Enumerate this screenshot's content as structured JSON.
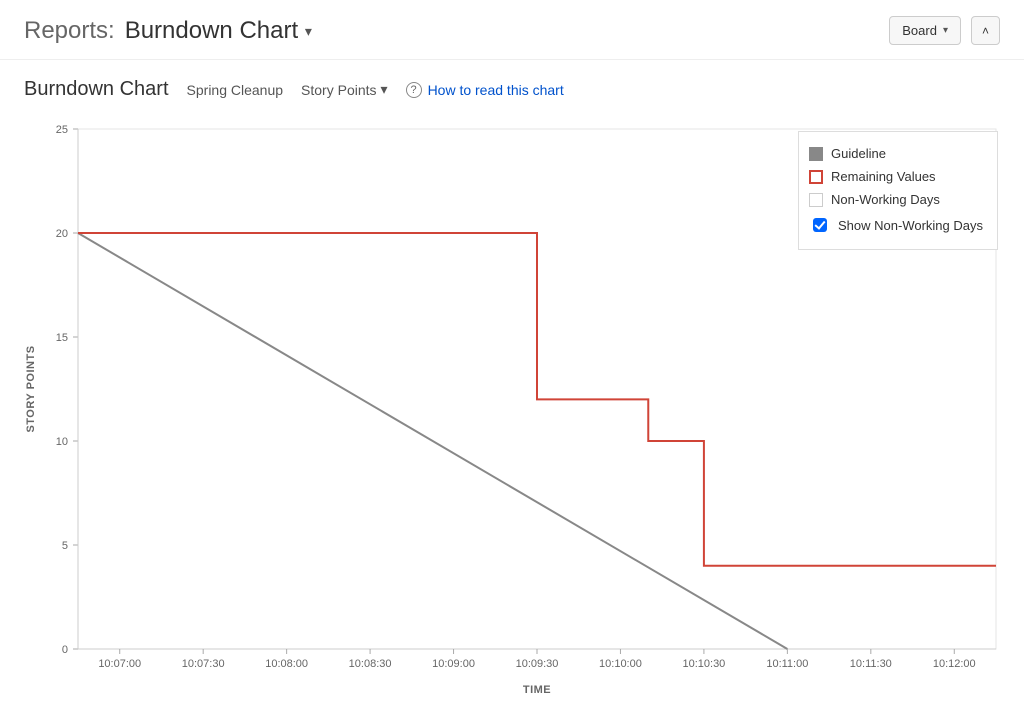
{
  "header": {
    "breadcrumb_label": "Reports:",
    "report_title": "Burndown Chart",
    "board_button": "Board",
    "collapse_icon_title": "Collapse"
  },
  "subheader": {
    "title": "Burndown Chart",
    "sprint_name": "Spring Cleanup",
    "metric_selector": "Story Points",
    "help_link": "How to read this chart"
  },
  "legend": {
    "guideline": "Guideline",
    "remaining": "Remaining Values",
    "nonworking": "Non-Working Days",
    "checkbox_label": "Show Non-Working Days",
    "checkbox_checked": true
  },
  "chart_data": {
    "type": "line",
    "xlabel": "TIME",
    "ylabel": "STORY POINTS",
    "ylim": [
      0,
      25
    ],
    "y_ticks": [
      0,
      5,
      10,
      15,
      20,
      25
    ],
    "x_ticks": [
      "10:07:00",
      "10:07:30",
      "10:08:00",
      "10:08:30",
      "10:09:00",
      "10:09:30",
      "10:10:00",
      "10:10:30",
      "10:11:00",
      "10:11:30",
      "10:12:00"
    ],
    "x_domain": [
      "10:06:45",
      "10:12:15"
    ],
    "series": [
      {
        "name": "Guideline",
        "color": "#888888",
        "style": "line",
        "points": [
          {
            "x": "10:06:45",
            "y": 20
          },
          {
            "x": "10:11:00",
            "y": 0
          }
        ]
      },
      {
        "name": "Remaining Values",
        "color": "#d04437",
        "style": "step",
        "points": [
          {
            "x": "10:06:45",
            "y": 20
          },
          {
            "x": "10:09:30",
            "y": 20
          },
          {
            "x": "10:09:30",
            "y": 12
          },
          {
            "x": "10:10:10",
            "y": 12
          },
          {
            "x": "10:10:10",
            "y": 10
          },
          {
            "x": "10:10:30",
            "y": 10
          },
          {
            "x": "10:10:30",
            "y": 4
          },
          {
            "x": "10:12:15",
            "y": 4
          }
        ]
      }
    ]
  }
}
